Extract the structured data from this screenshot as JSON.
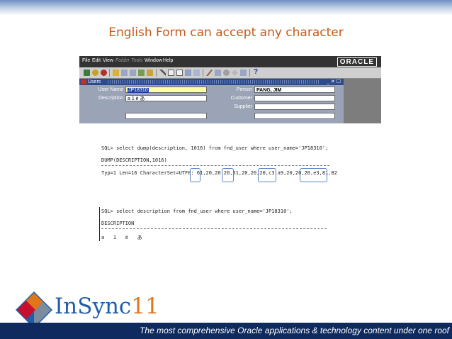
{
  "slide": {
    "title": "English Form can accept any character",
    "tagline": "The most comprehensive Oracle applications & technology content under one roof"
  },
  "logo": {
    "text_a": "InSync",
    "text_b": "11"
  },
  "app": {
    "menu": [
      {
        "label": "File",
        "dim": false
      },
      {
        "label": "Edit",
        "dim": false
      },
      {
        "label": "View",
        "dim": false
      },
      {
        "label": "Folder",
        "dim": true
      },
      {
        "label": "Tools",
        "dim": true
      },
      {
        "label": "Window",
        "dim": false
      },
      {
        "label": "Help",
        "dim": false
      }
    ],
    "brand": "ORACLE",
    "help_icon": "?",
    "window_title": "Users",
    "window_controls": "_ ✕ ☐",
    "form": {
      "user_name_label": "User Name",
      "user_name_value": "JP18310",
      "description_label": "Description",
      "description_value": "a  1  é  あ",
      "person_label": "Person",
      "person_value": "PANG, JIM",
      "customer_label": "Customer",
      "supplier_label": "Supplier"
    }
  },
  "sql1": {
    "query": "SQL> select dump(description, 1016) from fnd_user where user_name='JP18310';",
    "header": "DUMP(DESCRIPTION,1016)",
    "result_prefix": "Typ=1 Len=16 CharacterSet=UTF8: ",
    "result_values": "61,20,20,20,31,20,20,20,c3,a9,20,20,20,e3,81,82"
  },
  "sql2": {
    "query": "SQL> select description from fnd_user where user_name='JP18310';",
    "header": "DESCRIPTION",
    "result": "a   1   é   あ"
  },
  "colors": {
    "title": "#c8581a",
    "footer": "#0e2a5e",
    "oracle_menubar": "#333333",
    "highlight": "#5a82c6"
  }
}
